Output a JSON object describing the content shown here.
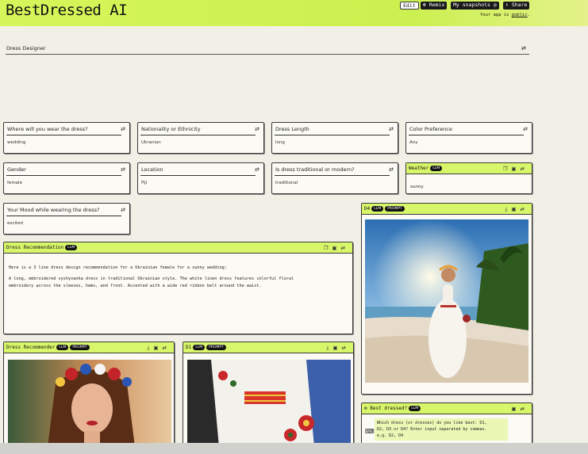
{
  "header": {
    "title": "BestDressed AI",
    "edit_label": "Edit",
    "remix_label": "⊛ Remix",
    "snapshots_label": "My snapshots",
    "snapshots_icon": "◎",
    "share_label": "↑ Share",
    "public_prefix": "Your app is ",
    "public_link": "public",
    "public_suffix": "."
  },
  "section": {
    "title": "Dress Designer",
    "icon": "⇄"
  },
  "inputs": [
    {
      "label": "Where will you wear the dress?",
      "value": "wedding"
    },
    {
      "label": "Nationality or Ethnicity",
      "value": "Ukranian"
    },
    {
      "label": "Dress Length",
      "value": "long"
    },
    {
      "label": "Color Preference",
      "value": "Any"
    },
    {
      "label": "Gender",
      "value": "female"
    },
    {
      "label": "Location",
      "value": "Fiji"
    },
    {
      "label": "Is dress traditional or modern?",
      "value": "traditional"
    },
    {
      "label": "Your Mood while wearing the dress?",
      "value": "excited"
    }
  ],
  "weather": {
    "title": "Weather",
    "badge": "LLM",
    "value": "sunny"
  },
  "recommendation": {
    "title": "Dress Recommendation",
    "badge": "LLM",
    "line1": "Here is a 3 line dress design recommendation for a Ukrainian female for a sunny wedding:",
    "line2": "A long, embroidered vyshyvanka dress in traditional Ukrainian style. The white linen dress features colorful floral",
    "line3": "embroidery across the sleeves, hems, and front. Accented with a wide red ribbon belt around the waist."
  },
  "recommender": {
    "title": "Dress Recommender",
    "badge1": "LLM",
    "badge2": "PROMPT"
  },
  "d1": {
    "title": "D1",
    "badge1": "LLM",
    "badge2": "PROMPT"
  },
  "d4": {
    "title": "D4",
    "badge1": "LLM",
    "badge2": "PROMPT"
  },
  "best": {
    "title": "Best dressed?",
    "badge": "LLM",
    "line1": "Which dress (or dresses) do you like best: D1,",
    "line2": "D2, D3 or D4? Enter input separated by commas.",
    "line3": "e.g. D2, D4"
  },
  "icons": {
    "settings": "⇄",
    "copy": "❐",
    "image": "▣",
    "download": "⤓",
    "gear": "⚙",
    "keyboard": "⌨"
  }
}
